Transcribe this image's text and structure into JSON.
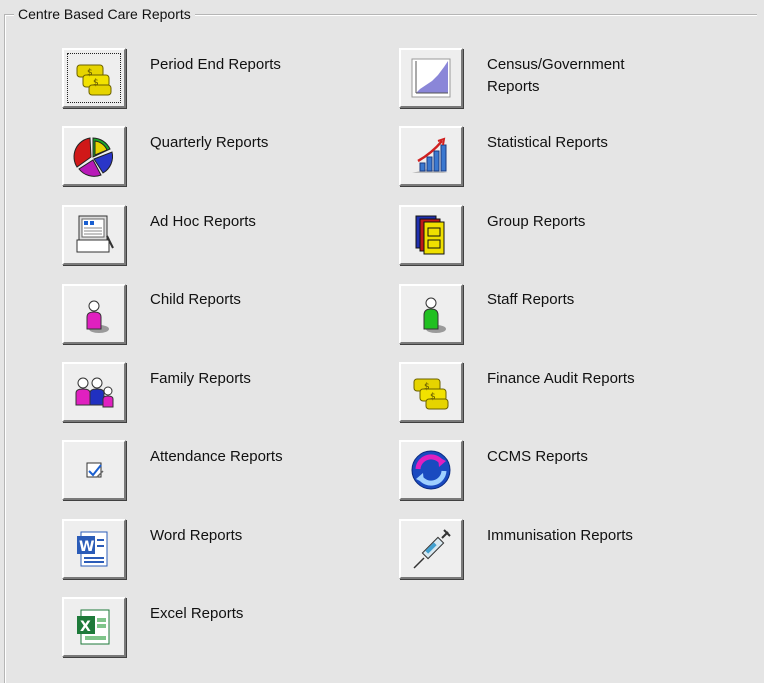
{
  "group": {
    "title": "Centre Based Care Reports"
  },
  "reports": {
    "period_end": "Period End Reports",
    "quarterly": "Quarterly Reports",
    "ad_hoc": "Ad Hoc Reports",
    "child": "Child Reports",
    "family": "Family Reports",
    "attendance": "Attendance Reports",
    "word": "Word Reports",
    "excel": "Excel Reports",
    "census_line1": "Census/Government",
    "census_line2": "Reports",
    "statistical": "Statistical Reports",
    "group": "Group Reports",
    "staff": "Staff Reports",
    "finance_audit": "Finance Audit Reports",
    "ccms": "CCMS Reports",
    "immunisation": "Immunisation Reports"
  },
  "icons": {
    "period_end": "money-icon",
    "quarterly": "pie-chart-icon",
    "ad_hoc": "computer-report-icon",
    "child": "child-person-icon",
    "family": "family-people-icon",
    "attendance": "attendance-icon",
    "word": "word-document-icon",
    "excel": "excel-spreadsheet-icon",
    "census": "area-chart-icon",
    "statistical": "bar-chart-icon",
    "group": "group-folders-icon",
    "staff": "staff-person-icon",
    "finance_audit": "money-icon",
    "ccms": "sync-arrows-icon",
    "immunisation": "syringe-icon"
  }
}
